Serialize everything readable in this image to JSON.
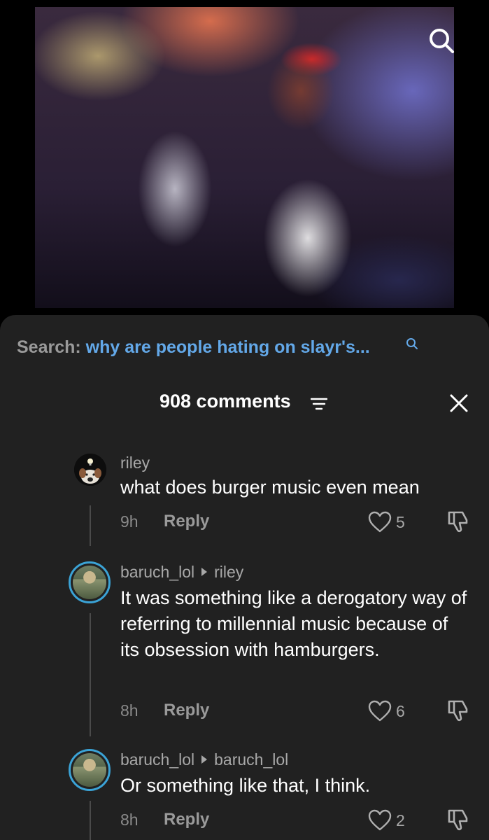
{
  "search": {
    "prefix": "Search:",
    "query": "why are people hating on slayr's..."
  },
  "header": {
    "count": "908 comments"
  },
  "comments": [
    {
      "user": "riley",
      "reply_to": "",
      "text": "what does burger music even mean",
      "time": "9h",
      "reply_label": "Reply",
      "likes": "5"
    },
    {
      "user": "baruch_lol",
      "reply_to": "riley",
      "text": "It was something like a derogatory way of referring to millennial music because of its obsession with hamburgers.",
      "time": "8h",
      "reply_label": "Reply",
      "likes": "6"
    },
    {
      "user": "baruch_lol",
      "reply_to": "baruch_lol",
      "text": "Or something like that, I think.",
      "time": "8h",
      "reply_label": "Reply",
      "likes": "2"
    }
  ],
  "colors": {
    "accent_blue": "#63a8e8",
    "sheet_bg": "#212121",
    "avatar_ring": "#3ba3d6"
  },
  "icons": [
    "search-icon",
    "filter-icon",
    "close-icon",
    "heart-icon",
    "dislike-icon"
  ]
}
